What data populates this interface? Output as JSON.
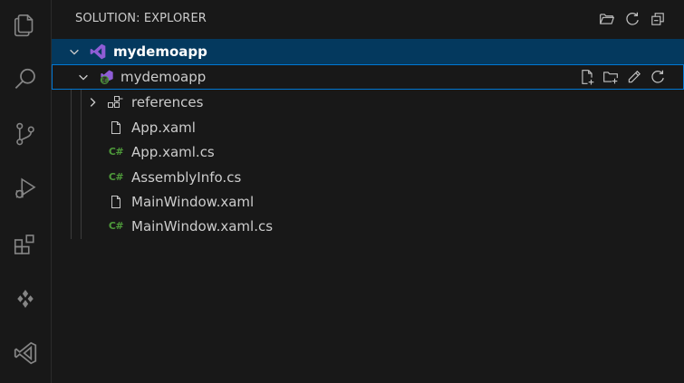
{
  "activity_bar": {
    "items": [
      {
        "icon": "explorer-icon"
      },
      {
        "icon": "search-icon"
      },
      {
        "icon": "source-control-icon"
      },
      {
        "icon": "run-debug-icon"
      },
      {
        "icon": "extensions-icon"
      },
      {
        "icon": "copilot-icon"
      },
      {
        "icon": "visual-studio-icon"
      }
    ]
  },
  "sidebar": {
    "title": "SOLUTION: EXPLORER",
    "header_actions": [
      "open-folder-icon",
      "refresh-icon",
      "collapse-all-icon"
    ],
    "tree": {
      "solution": {
        "label": "mydemoapp"
      },
      "project": {
        "label": "mydemoapp",
        "actions": [
          "new-file-icon",
          "new-folder-icon",
          "rename-icon",
          "refresh-icon"
        ]
      },
      "items": [
        {
          "label": "references",
          "icon": "references-icon",
          "collapsible": true
        },
        {
          "label": "App.xaml",
          "icon": "file-icon"
        },
        {
          "label": "App.xaml.cs",
          "icon": "csharp-icon"
        },
        {
          "label": "AssemblyInfo.cs",
          "icon": "csharp-icon"
        },
        {
          "label": "MainWindow.xaml",
          "icon": "file-icon"
        },
        {
          "label": "MainWindow.xaml.cs",
          "icon": "csharp-icon"
        }
      ]
    }
  },
  "colors": {
    "background": "#181818",
    "selected_row": "#04395e",
    "focus_border": "#0078d4",
    "csharp_green": "#4e9a3a",
    "vs_purple": "#8f5dd6"
  }
}
